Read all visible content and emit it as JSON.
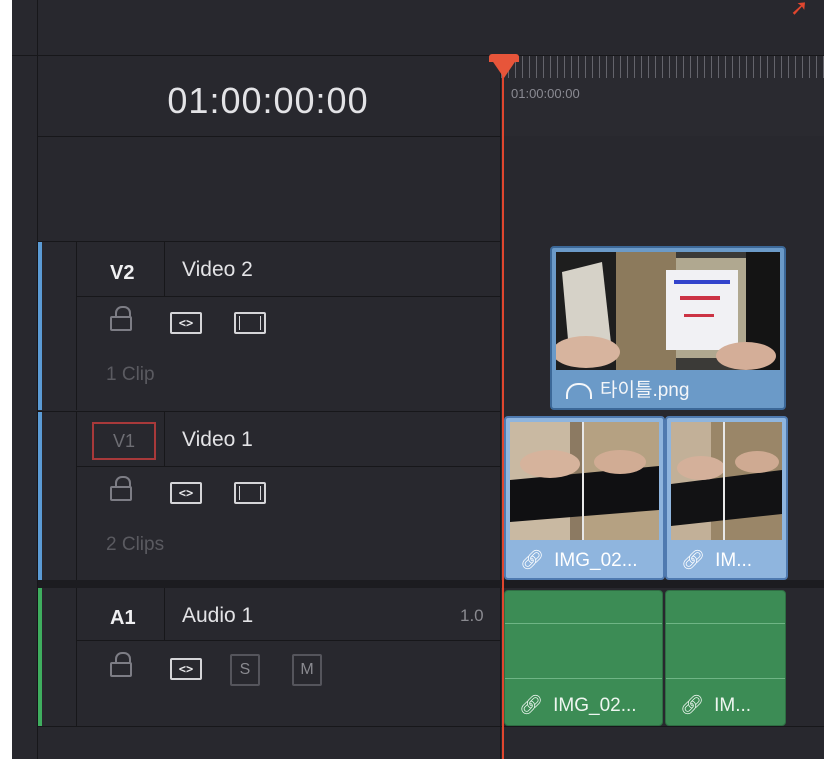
{
  "timeline": {
    "timecode": "01:00:00:00",
    "ruler_label": "01:00:00:00"
  },
  "tracks": {
    "v2": {
      "id": "V2",
      "name": "Video 2",
      "clip_count": "1 Clip",
      "color": "#5b9bd5"
    },
    "v1": {
      "id": "V1",
      "name": "Video 1",
      "clip_count": "2 Clips",
      "color": "#5b9bd5"
    },
    "a1": {
      "id": "A1",
      "name": "Audio 1",
      "volume": "1.0",
      "solo": "S",
      "mute": "M",
      "color": "#3fae5f"
    }
  },
  "clips": {
    "v2_title": {
      "label": "타이틀.png",
      "icon": "speedometer-icon"
    },
    "v1_clip1": {
      "label": "IMG_02...",
      "icon": "link-icon"
    },
    "v1_clip2": {
      "label": "IM...",
      "icon": "link-icon"
    },
    "a1_clip1": {
      "label": "IMG_02...",
      "icon": "link-icon"
    },
    "a1_clip2": {
      "label": "IM...",
      "icon": "link-icon"
    }
  },
  "icons": {
    "auto_select": "<>",
    "playhead_color": "#e7553a",
    "video_clip_color": "#6b9ac8",
    "audio_clip_color": "#3c8c55"
  }
}
